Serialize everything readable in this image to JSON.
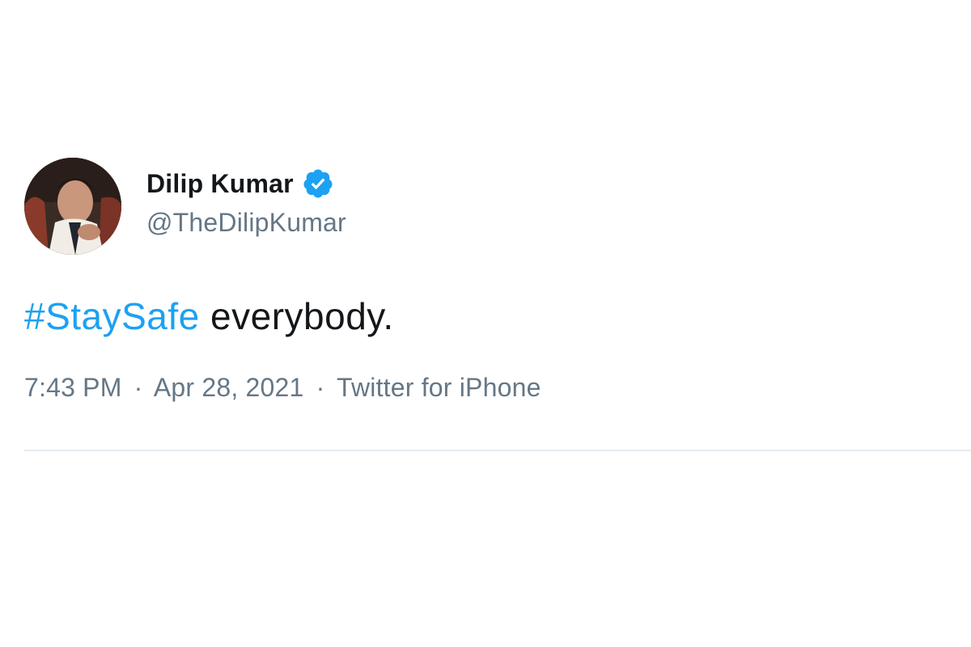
{
  "tweet": {
    "author": {
      "display_name": "Dilip Kumar",
      "handle": "@TheDilipKumar",
      "verified": true,
      "avatar": "profile-photo"
    },
    "text": {
      "hashtag": "#StaySafe",
      "rest": " everybody."
    },
    "meta": {
      "time": "7:43 PM",
      "separator_1": "·",
      "date": "Apr 28, 2021",
      "separator_2": "·",
      "source": "Twitter for iPhone"
    }
  },
  "colors": {
    "link": "#1da1f2",
    "primary_text": "#14171a",
    "secondary_text": "#657786",
    "divider": "#e6ecf0",
    "verified_badge": "#1da1f2"
  },
  "icons": {
    "verified": "verified-badge-icon"
  }
}
